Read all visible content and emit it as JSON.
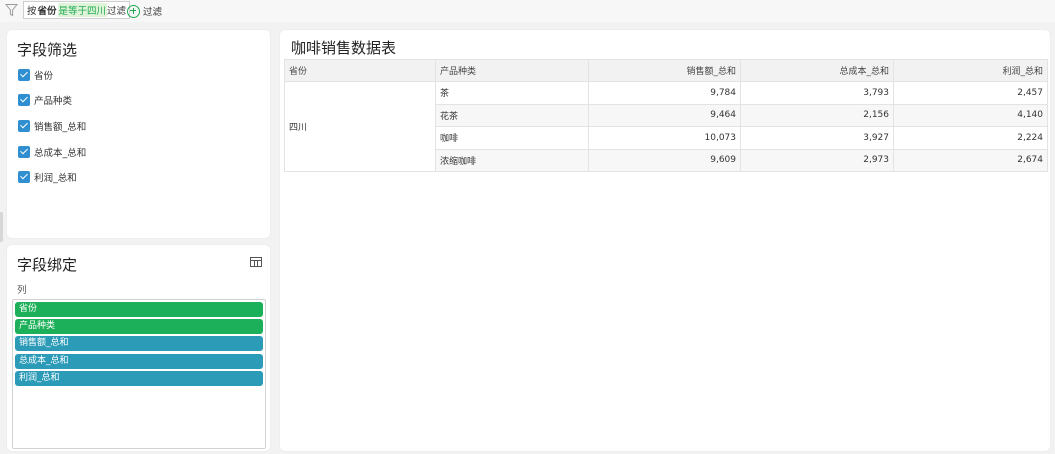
{
  "filterbar": {
    "chip_prefix": "按",
    "chip_field": "省份",
    "chip_condition": "是等于四川",
    "chip_suffix": "过滤",
    "add_label": "过滤"
  },
  "field_filter": {
    "title": "字段筛选",
    "items": [
      {
        "label": "省份",
        "checked": true
      },
      {
        "label": "产品种类",
        "checked": true
      },
      {
        "label": "销售额_总和",
        "checked": true
      },
      {
        "label": "总成本_总和",
        "checked": true
      },
      {
        "label": "利润_总和",
        "checked": true
      }
    ]
  },
  "field_binding": {
    "title": "字段绑定",
    "column_label": "列",
    "pills": [
      {
        "label": "省份",
        "kind": "dimension"
      },
      {
        "label": "产品种类",
        "kind": "dimension"
      },
      {
        "label": "销售额_总和",
        "kind": "measure"
      },
      {
        "label": "总成本_总和",
        "kind": "measure"
      },
      {
        "label": "利润_总和",
        "kind": "measure"
      }
    ]
  },
  "table": {
    "title": "咖啡销售数据表",
    "headers": [
      "省份",
      "产品种类",
      "销售额_总和",
      "总成本_总和",
      "利润_总和"
    ],
    "group_label": "四川",
    "rows": [
      [
        "茶",
        "9,784",
        "3,793",
        "2,457"
      ],
      [
        "花茶",
        "9,464",
        "2,156",
        "4,140"
      ],
      [
        "咖啡",
        "10,073",
        "3,927",
        "2,224"
      ],
      [
        "浓缩咖啡",
        "9,609",
        "2,973",
        "2,674"
      ]
    ]
  },
  "colors": {
    "accent_green": "#1db05a",
    "measure_blue": "#2c9bb8",
    "checkbox_blue": "#2f8fd0"
  }
}
